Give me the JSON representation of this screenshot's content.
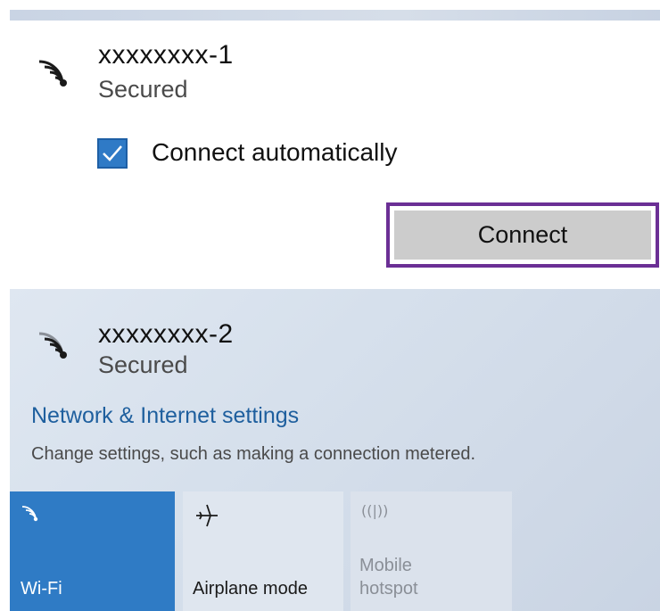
{
  "networks": [
    {
      "name": "xxxxxxxx-1",
      "status": "Secured",
      "icon": "wifi-secured-icon"
    },
    {
      "name": "xxxxxxxx-2",
      "status": "Secured",
      "icon": "wifi-secured-icon"
    }
  ],
  "connect_auto": {
    "label": "Connect automatically",
    "checked": true
  },
  "connect_button": {
    "label": "Connect"
  },
  "settings": {
    "link": "Network & Internet settings",
    "description": "Change settings, such as making a connection metered."
  },
  "quick_actions": [
    {
      "label": "Wi-Fi",
      "icon": "wifi-icon",
      "active": true
    },
    {
      "label": "Airplane mode",
      "icon": "airplane-icon",
      "active": false
    },
    {
      "label_line1": "Mobile",
      "label_line2": "hotspot",
      "icon": "mobile-hotspot-icon",
      "active": false
    }
  ],
  "colors": {
    "accent": "#2f7bc5",
    "link": "#1e5f9e",
    "highlight_outline": "#6b2f95",
    "button_bg": "#cccccc"
  }
}
